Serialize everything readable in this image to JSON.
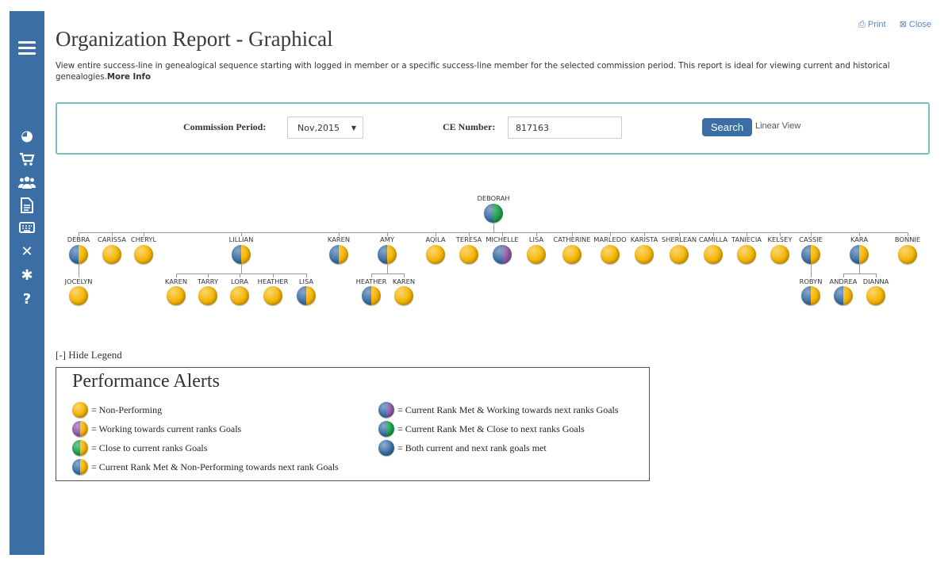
{
  "header": {
    "title": "Organization Report - Graphical",
    "description": "View entire success-line in genealogical sequence starting with logged in member or a specific success-line member for the selected commission period. This report is ideal for viewing current and historical genealogies.",
    "more_info": "More Info",
    "print_label": "Print",
    "close_label": "Close"
  },
  "sidebar": {
    "items": [
      "menu-icon",
      "dashboard-icon",
      "cart-icon",
      "team-icon",
      "document-icon",
      "keyboard-icon",
      "tools-icon",
      "asterisk-icon",
      "help-icon"
    ]
  },
  "search": {
    "period_label": "Commission Period:",
    "period_value": "Nov,2015",
    "ce_label": "CE Number:",
    "ce_value": "817163",
    "button_label": "Search",
    "linear_view": "Linear View"
  },
  "colors": {
    "yellow": "#f5b400",
    "blue": "#3a6ea5",
    "purple": "#8b5ba8",
    "green": "#19a14a",
    "sidebar": "#3a6ea5"
  },
  "tree": {
    "root": {
      "name": "DEBORAH",
      "status": "blue-green"
    },
    "level1": [
      {
        "name": "DEBRA",
        "status": "blue-yellow"
      },
      {
        "name": "CARISSA",
        "status": "yellow"
      },
      {
        "name": "CHERYL",
        "status": "yellow"
      },
      {
        "name": "LILLIAN",
        "status": "blue-yellow"
      },
      {
        "name": "KAREN",
        "status": "blue-yellow"
      },
      {
        "name": "AMY",
        "status": "blue-yellow"
      },
      {
        "name": "AQILA",
        "status": "yellow"
      },
      {
        "name": "TERESA",
        "status": "yellow"
      },
      {
        "name": "MICHELLE",
        "status": "blue-purple"
      },
      {
        "name": "LISA",
        "status": "yellow"
      },
      {
        "name": "CATHERINE",
        "status": "yellow"
      },
      {
        "name": "MARLEDO",
        "status": "yellow"
      },
      {
        "name": "KARISTA",
        "status": "yellow"
      },
      {
        "name": "SHERLEAN",
        "status": "yellow"
      },
      {
        "name": "CAMILLA",
        "status": "yellow"
      },
      {
        "name": "TANIECIA",
        "status": "yellow"
      },
      {
        "name": "KELSEY",
        "status": "yellow"
      },
      {
        "name": "CASSIE",
        "status": "blue-yellow"
      },
      {
        "name": "KARA",
        "status": "blue-yellow"
      },
      {
        "name": "BONNIE",
        "status": "yellow"
      }
    ],
    "level2": [
      {
        "name": "JOCELYN",
        "status": "yellow",
        "parent": 0
      },
      {
        "name": "KAREN",
        "status": "yellow",
        "parent": 3
      },
      {
        "name": "TARRY",
        "status": "yellow",
        "parent": 3
      },
      {
        "name": "LORA",
        "status": "yellow",
        "parent": 3
      },
      {
        "name": "HEATHER",
        "status": "yellow",
        "parent": 3
      },
      {
        "name": "LISA",
        "status": "blue-yellow",
        "parent": 3
      },
      {
        "name": "HEATHER",
        "status": "blue-yellow",
        "parent": 5
      },
      {
        "name": "KAREN",
        "status": "yellow",
        "parent": 5
      },
      {
        "name": "ROBYN",
        "status": "blue-yellow",
        "parent": 17
      },
      {
        "name": "ANDREA",
        "status": "blue-yellow",
        "parent": 18
      },
      {
        "name": "DIANNA",
        "status": "yellow",
        "parent": 18
      }
    ]
  },
  "legend": {
    "toggle": "[-] Hide Legend",
    "title": "Performance Alerts",
    "items": [
      {
        "status": "yellow",
        "text": "= Non-Performing"
      },
      {
        "status": "purple-yellow",
        "text": "= Working towards current ranks Goals"
      },
      {
        "status": "green-yellow",
        "text": "= Close to current ranks Goals"
      },
      {
        "status": "blue-yellow",
        "text": "= Current Rank Met & Non-Performing towards next rank Goals"
      },
      {
        "status": "blue-purple",
        "text": "= Current Rank Met & Working towards next ranks Goals"
      },
      {
        "status": "blue-green",
        "text": "= Current Rank Met & Close to next ranks Goals"
      },
      {
        "status": "blue",
        "text": "= Both current and next rank goals met"
      }
    ]
  }
}
